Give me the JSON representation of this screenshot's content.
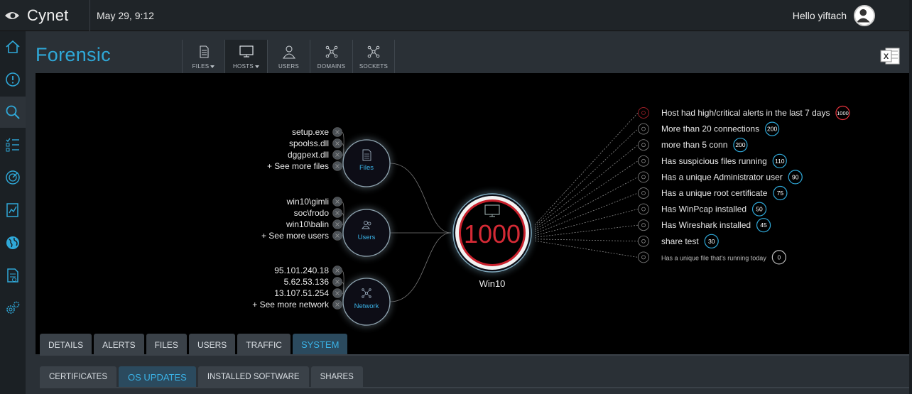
{
  "app": {
    "brand": "Cynet",
    "datetime": "May 29, 9:12",
    "greeting": "Hello yiftach"
  },
  "sidebar": [
    {
      "icon": "home-icon"
    },
    {
      "icon": "alert-icon"
    },
    {
      "icon": "search-icon",
      "active": true
    },
    {
      "icon": "checklist-icon"
    },
    {
      "icon": "radar-icon"
    },
    {
      "icon": "report-icon"
    },
    {
      "icon": "globe-icon"
    },
    {
      "icon": "document-icon"
    },
    {
      "icon": "settings-icon"
    }
  ],
  "page": {
    "title": "Forensic"
  },
  "type_tabs": [
    {
      "label": "FILES",
      "icon": "file-icon",
      "dropdown": true
    },
    {
      "label": "HOSTS",
      "icon": "monitor-icon",
      "dropdown": true,
      "active": true
    },
    {
      "label": "USERS",
      "icon": "user-icon"
    },
    {
      "label": "DOMAINS",
      "icon": "network-icon"
    },
    {
      "label": "SOCKETS",
      "icon": "network-icon"
    }
  ],
  "graph": {
    "host": {
      "name": "Win10",
      "score": "1000"
    },
    "groups": [
      {
        "label": "Files",
        "items": [
          "setup.exe",
          "spoolss.dll",
          "dggpext.dll",
          "+ See more files"
        ]
      },
      {
        "label": "Users",
        "items": [
          "win10\\gimli",
          "soc\\frodo",
          "win10\\balin",
          "+ See more users"
        ]
      },
      {
        "label": "Network",
        "items": [
          "95.101.240.18",
          "5.62.53.136",
          "13.107.51.254",
          "+ See more network"
        ]
      }
    ],
    "indicators": [
      {
        "text": "Host had high/critical alerts in the last 7 days",
        "score": "1000",
        "color": "#e8333d"
      },
      {
        "text": "More than 20 connections",
        "score": "200",
        "color": "#2fa8d8"
      },
      {
        "text": "more than 5 conn",
        "score": "200",
        "color": "#2fa8d8"
      },
      {
        "text": "Has suspicious files running",
        "score": "110",
        "color": "#2fa8d8"
      },
      {
        "text": "Has a unique Administrator user",
        "score": "90",
        "color": "#2fa8d8"
      },
      {
        "text": "Has a unique root certificate",
        "score": "75",
        "color": "#2fa8d8"
      },
      {
        "text": "Has WinPcap installed",
        "score": "50",
        "color": "#2fa8d8"
      },
      {
        "text": "Has Wireshark installed",
        "score": "45",
        "color": "#2fa8d8"
      },
      {
        "text": "share test",
        "score": "30",
        "color": "#2fa8d8"
      },
      {
        "text": "Has a unique file that's running today",
        "score": "0",
        "color": "#bbbbbb",
        "small": true
      }
    ]
  },
  "detail_tabs": [
    "DETAILS",
    "ALERTS",
    "FILES",
    "USERS",
    "TRAFFIC",
    "SYSTEM"
  ],
  "detail_active": "SYSTEM",
  "sub_tabs": [
    "CERTIFICATES",
    "OS UPDATES",
    "INSTALLED SOFTWARE",
    "SHARES"
  ],
  "sub_active": "OS UPDATES"
}
